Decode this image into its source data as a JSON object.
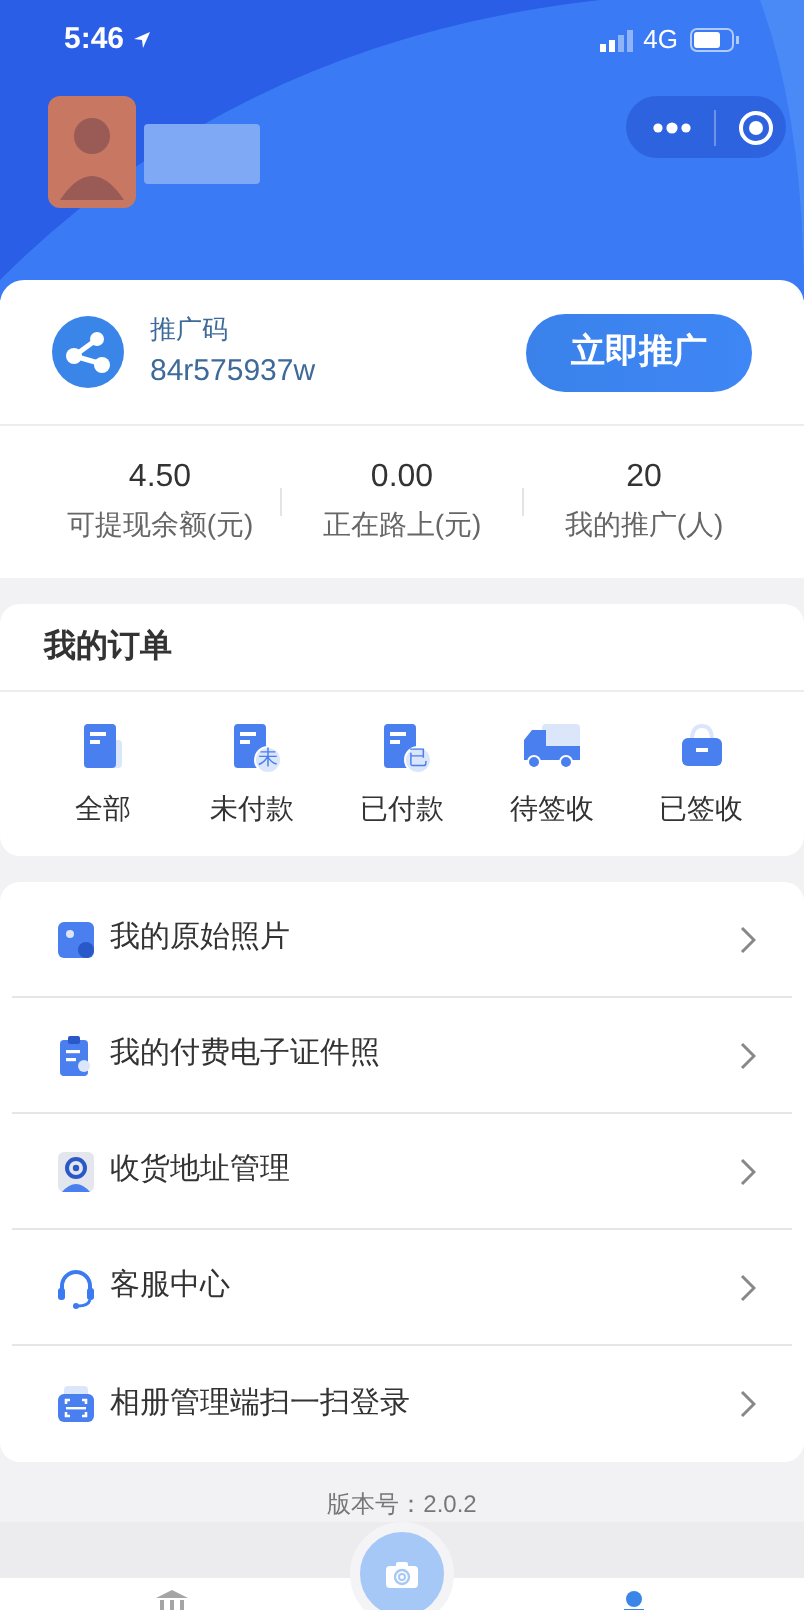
{
  "status_bar": {
    "time": "5:46",
    "network": "4G"
  },
  "promo": {
    "label": "推广码",
    "code": "84r575937w",
    "button": "立即推广"
  },
  "stats": [
    {
      "value": "4.50",
      "label": "可提现余额(元)"
    },
    {
      "value": "0.00",
      "label": "正在路上(元)"
    },
    {
      "value": "20",
      "label": "我的推广(人)"
    }
  ],
  "orders": {
    "title": "我的订单",
    "items": [
      {
        "kind": "all",
        "label": "全部"
      },
      {
        "kind": "unpaid",
        "badge": "未",
        "label": "未付款"
      },
      {
        "kind": "paid",
        "badge": "已",
        "label": "已付款"
      },
      {
        "kind": "shipping",
        "label": "待签收"
      },
      {
        "kind": "received",
        "label": "已签收"
      }
    ]
  },
  "menu": [
    {
      "kind": "photo",
      "label": "我的原始照片"
    },
    {
      "kind": "document",
      "label": "我的付费电子证件照"
    },
    {
      "kind": "address",
      "label": "收货地址管理"
    },
    {
      "kind": "service",
      "label": "客服中心"
    },
    {
      "kind": "scan",
      "label": "相册管理端扫一扫登录"
    }
  ],
  "version": "版本号：2.0.2",
  "tab_bar": [
    {
      "kind": "home",
      "selected": false
    },
    {
      "kind": "profile",
      "selected": true
    }
  ]
}
